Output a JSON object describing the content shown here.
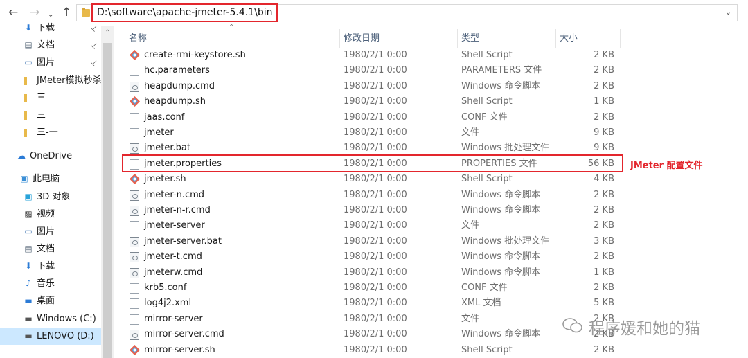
{
  "toolbar": {
    "back_icon": "arrow-left-icon",
    "forward_icon": "arrow-right-icon",
    "recent_icon": "chevron-down-icon",
    "up_icon": "arrow-up-icon"
  },
  "address": {
    "path": "D:\\software\\apache-jmeter-5.4.1\\bin"
  },
  "sidebar": {
    "items": [
      {
        "label": "下载",
        "icon": "download-icon",
        "pinned": true
      },
      {
        "label": "文档",
        "icon": "document-icon",
        "pinned": true
      },
      {
        "label": "图片",
        "icon": "pictures-icon",
        "pinned": true
      },
      {
        "label": "JMeter模拟秒杀",
        "icon": "folder-icon",
        "pinned": false
      },
      {
        "label": "三",
        "icon": "folder-icon",
        "pinned": false
      },
      {
        "label": "三",
        "icon": "folder-icon",
        "pinned": false
      },
      {
        "label": "三-一",
        "icon": "folder-icon",
        "pinned": false
      },
      {
        "label": "OneDrive",
        "icon": "cloud-icon",
        "pinned": false
      },
      {
        "label": "此电脑",
        "icon": "computer-icon",
        "pinned": false
      },
      {
        "label": "3D 对象",
        "icon": "cube-icon",
        "pinned": false
      },
      {
        "label": "视频",
        "icon": "video-icon",
        "pinned": false
      },
      {
        "label": "图片",
        "icon": "pictures-icon",
        "pinned": false
      },
      {
        "label": "文档",
        "icon": "document-icon",
        "pinned": false
      },
      {
        "label": "下载",
        "icon": "download-icon",
        "pinned": false
      },
      {
        "label": "音乐",
        "icon": "music-icon",
        "pinned": false
      },
      {
        "label": "桌面",
        "icon": "desktop-icon",
        "pinned": false
      },
      {
        "label": "Windows (C:)",
        "icon": "drive-icon",
        "pinned": false
      },
      {
        "label": "LENOVO (D:)",
        "icon": "drive-icon",
        "pinned": false,
        "selected": true
      }
    ]
  },
  "columns": {
    "name": "名称",
    "date": "修改日期",
    "type": "类型",
    "size": "大小"
  },
  "files": [
    {
      "name": "create-rmi-keystore.sh",
      "date": "1980/2/1 0:00",
      "type": "Shell Script",
      "size": "2 KB",
      "kind": "sh"
    },
    {
      "name": "hc.parameters",
      "date": "1980/2/1 0:00",
      "type": "PARAMETERS 文件",
      "size": "2 KB",
      "kind": "doc"
    },
    {
      "name": "heapdump.cmd",
      "date": "1980/2/1 0:00",
      "type": "Windows 命令脚本",
      "size": "2 KB",
      "kind": "cmd"
    },
    {
      "name": "heapdump.sh",
      "date": "1980/2/1 0:00",
      "type": "Shell Script",
      "size": "1 KB",
      "kind": "sh"
    },
    {
      "name": "jaas.conf",
      "date": "1980/2/1 0:00",
      "type": "CONF 文件",
      "size": "2 KB",
      "kind": "doc"
    },
    {
      "name": "jmeter",
      "date": "1980/2/1 0:00",
      "type": "文件",
      "size": "9 KB",
      "kind": "doc"
    },
    {
      "name": "jmeter.bat",
      "date": "1980/2/1 0:00",
      "type": "Windows 批处理文件",
      "size": "9 KB",
      "kind": "cmd"
    },
    {
      "name": "jmeter.properties",
      "date": "1980/2/1 0:00",
      "type": "PROPERTIES 文件",
      "size": "56 KB",
      "kind": "doc"
    },
    {
      "name": "jmeter.sh",
      "date": "1980/2/1 0:00",
      "type": "Shell Script",
      "size": "4 KB",
      "kind": "sh"
    },
    {
      "name": "jmeter-n.cmd",
      "date": "1980/2/1 0:00",
      "type": "Windows 命令脚本",
      "size": "2 KB",
      "kind": "cmd"
    },
    {
      "name": "jmeter-n-r.cmd",
      "date": "1980/2/1 0:00",
      "type": "Windows 命令脚本",
      "size": "2 KB",
      "kind": "cmd"
    },
    {
      "name": "jmeter-server",
      "date": "1980/2/1 0:00",
      "type": "文件",
      "size": "2 KB",
      "kind": "doc"
    },
    {
      "name": "jmeter-server.bat",
      "date": "1980/2/1 0:00",
      "type": "Windows 批处理文件",
      "size": "3 KB",
      "kind": "cmd"
    },
    {
      "name": "jmeter-t.cmd",
      "date": "1980/2/1 0:00",
      "type": "Windows 命令脚本",
      "size": "2 KB",
      "kind": "cmd"
    },
    {
      "name": "jmeterw.cmd",
      "date": "1980/2/1 0:00",
      "type": "Windows 命令脚本",
      "size": "1 KB",
      "kind": "cmd"
    },
    {
      "name": "krb5.conf",
      "date": "1980/2/1 0:00",
      "type": "CONF 文件",
      "size": "2 KB",
      "kind": "doc"
    },
    {
      "name": "log4j2.xml",
      "date": "1980/2/1 0:00",
      "type": "XML 文档",
      "size": "5 KB",
      "kind": "doc"
    },
    {
      "name": "mirror-server",
      "date": "1980/2/1 0:00",
      "type": "文件",
      "size": "2 KB",
      "kind": "doc"
    },
    {
      "name": "mirror-server.cmd",
      "date": "1980/2/1 0:00",
      "type": "Windows 命令脚本",
      "size": "2 KB",
      "kind": "cmd"
    },
    {
      "name": "mirror-server.sh",
      "date": "1980/2/1 0:00",
      "type": "Shell Script",
      "size": "2 KB",
      "kind": "sh"
    }
  ],
  "annotation": {
    "text": "JMeter 配置文件"
  },
  "watermark": {
    "text": "程序媛和她的猫"
  },
  "colors": {
    "highlight": "#e3262d",
    "selected_bg": "#cce8ff",
    "header_text": "#4c607a"
  }
}
